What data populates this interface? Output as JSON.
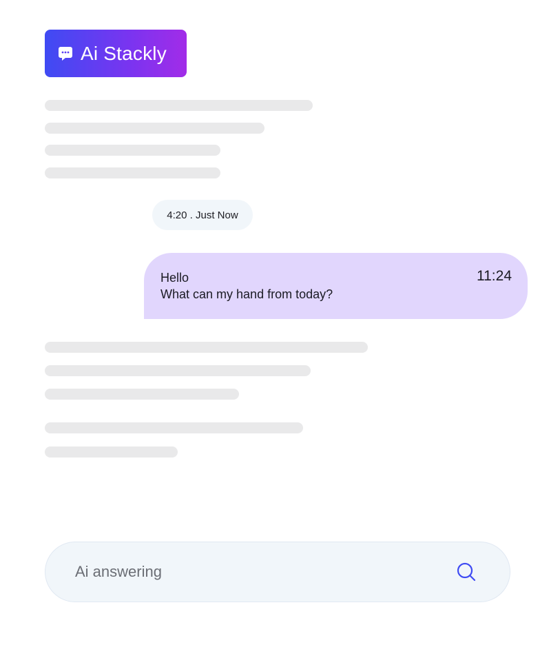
{
  "brand": {
    "name": "Ai Stackly",
    "icon": "chat-bubble-icon",
    "gradient_start": "#3f4bf3",
    "gradient_end": "#a22ce8"
  },
  "conversation": {
    "timestamp_label": "4:20 . Just Now",
    "user_message": {
      "lines": [
        "Hello",
        "What can my hand from today?"
      ],
      "time": "11:24",
      "bubble_color": "#e1d6fd"
    }
  },
  "composer": {
    "placeholder": "Ai answering",
    "search_icon": "search-icon",
    "accent_color": "#3f4bf3"
  },
  "colors": {
    "skeleton": "#e9e9ea",
    "pill_background": "#f1f6fa"
  }
}
